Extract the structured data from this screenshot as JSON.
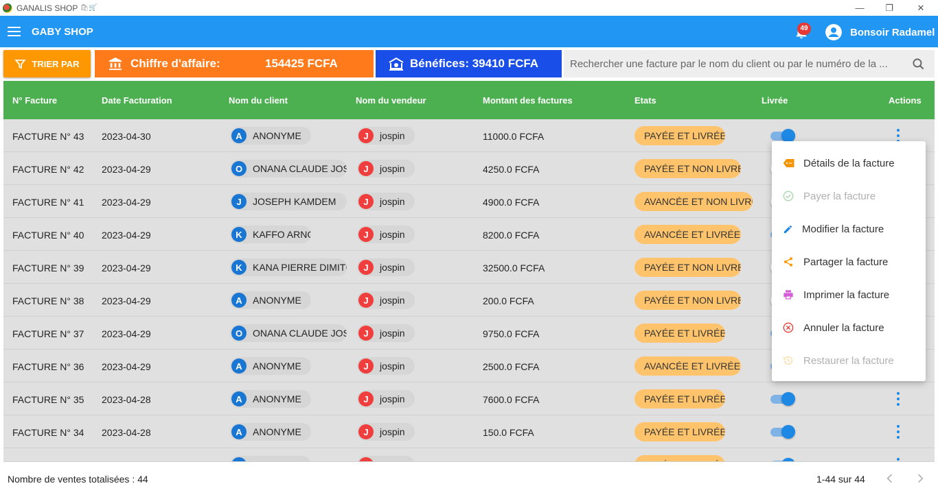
{
  "window": {
    "title": "GANALIS SHOP",
    "title_icons": "🛍🛒",
    "controls": {
      "minimize": "—",
      "maximize": "❐",
      "close": "✕"
    }
  },
  "appbar": {
    "shop_name": "GABY SHOP",
    "notification_count": "49",
    "greeting": "Bonsoir Radamel",
    "icons": [
      "menu-icon",
      "bell-icon",
      "account-icon"
    ]
  },
  "toolbar": {
    "sort_label": "TRIER PAR",
    "revenue_label": "Chiffre d'affaire:",
    "revenue_value": "154425 FCFA",
    "profit_label": "Bénéfices: 39410 FCFA",
    "search_placeholder": "Rechercher une facture par le nom du client ou par le numéro de la ..."
  },
  "colors": {
    "appbar": "#2196f3",
    "sort_button": "#ff9800",
    "revenue": "#ff7a1a",
    "profit": "#1a4ee8",
    "table_header": "#4caf50",
    "status_chip": "#ffc46b"
  },
  "table": {
    "headers": [
      "N° Facture",
      "Date Facturation",
      "Nom du client",
      "Nom du vendeur",
      "Montant des factures",
      "Etats",
      "Livrée",
      "Actions"
    ],
    "rows": [
      {
        "invoice": "FACTURE N° 43",
        "date": "2023-04-30",
        "client_initial": "A",
        "client": "ANONYME",
        "seller_initial": "J",
        "seller": "jospin",
        "amount": "11000.0 FCFA",
        "status": "PAYÉE ET LIVRÉE",
        "delivered": true
      },
      {
        "invoice": "FACTURE N° 42",
        "date": "2023-04-29",
        "client_initial": "O",
        "client": "ONANA  CLAUDE JOSEPH",
        "seller_initial": "J",
        "seller": "jospin",
        "amount": "4250.0 FCFA",
        "status": "PAYÉE ET NON LIVRÉE",
        "delivered": false
      },
      {
        "invoice": "FACTURE N° 41",
        "date": "2023-04-29",
        "client_initial": "J",
        "client": "JOSEPH KAMDEM",
        "seller_initial": "J",
        "seller": "jospin",
        "amount": "4900.0 FCFA",
        "status": "AVANCÉE ET NON LIVRÉE",
        "delivered": false
      },
      {
        "invoice": "FACTURE N° 40",
        "date": "2023-04-29",
        "client_initial": "K",
        "client": "KAFFO ARNOLD",
        "seller_initial": "J",
        "seller": "jospin",
        "amount": "8200.0 FCFA",
        "status": "AVANCÉE ET LIVRÉE",
        "delivered": true
      },
      {
        "invoice": "FACTURE N° 39",
        "date": "2023-04-29",
        "client_initial": "K",
        "client": "KANA PIERRE DIMITRI",
        "seller_initial": "J",
        "seller": "jospin",
        "amount": "32500.0 FCFA",
        "status": "PAYÉE ET NON LIVRÉE",
        "delivered": false
      },
      {
        "invoice": "FACTURE N° 38",
        "date": "2023-04-29",
        "client_initial": "A",
        "client": "ANONYME",
        "seller_initial": "J",
        "seller": "jospin",
        "amount": "200.0 FCFA",
        "status": "PAYÉE ET NON LIVRÉE",
        "delivered": false
      },
      {
        "invoice": "FACTURE N° 37",
        "date": "2023-04-29",
        "client_initial": "O",
        "client": "ONANA  CLAUDE JOSEPH",
        "seller_initial": "J",
        "seller": "jospin",
        "amount": "9750.0 FCFA",
        "status": "PAYÉE ET LIVRÉE",
        "delivered": true
      },
      {
        "invoice": "FACTURE N° 36",
        "date": "2023-04-29",
        "client_initial": "A",
        "client": "ANONYME",
        "seller_initial": "J",
        "seller": "jospin",
        "amount": "2500.0 FCFA",
        "status": "AVANCÉE ET LIVRÉE",
        "delivered": true
      },
      {
        "invoice": "FACTURE N° 35",
        "date": "2023-04-28",
        "client_initial": "A",
        "client": "ANONYME",
        "seller_initial": "J",
        "seller": "jospin",
        "amount": "7600.0 FCFA",
        "status": "PAYÉE ET LIVRÉE",
        "delivered": true
      },
      {
        "invoice": "FACTURE N° 34",
        "date": "2023-04-28",
        "client_initial": "A",
        "client": "ANONYME",
        "seller_initial": "J",
        "seller": "jospin",
        "amount": "150.0 FCFA",
        "status": "PAYÉE ET LIVRÉE",
        "delivered": true
      },
      {
        "invoice": "",
        "date": "",
        "client_initial": "",
        "client": "",
        "seller_initial": "",
        "seller": "",
        "amount": "",
        "status": "PAYÉE ET LIVRÉE",
        "delivered": true
      }
    ]
  },
  "context_menu": {
    "items": [
      {
        "label": "Détails de la facture",
        "icon": "label-icon",
        "enabled": true
      },
      {
        "label": "Payer la facture",
        "icon": "check-circle-icon",
        "enabled": false
      },
      {
        "label": "Modifier la facture",
        "icon": "edit-icon",
        "enabled": true
      },
      {
        "label": "Partager la facture",
        "icon": "share-icon",
        "enabled": true
      },
      {
        "label": "Imprimer la facture",
        "icon": "print-icon",
        "enabled": true
      },
      {
        "label": "Annuler la facture",
        "icon": "cancel-icon",
        "enabled": true
      },
      {
        "label": "Restaurer la facture",
        "icon": "restore-icon",
        "enabled": false
      }
    ]
  },
  "footer": {
    "total_sales": "Nombre de ventes totalisées : 44",
    "pagination": "1-44 sur 44"
  }
}
